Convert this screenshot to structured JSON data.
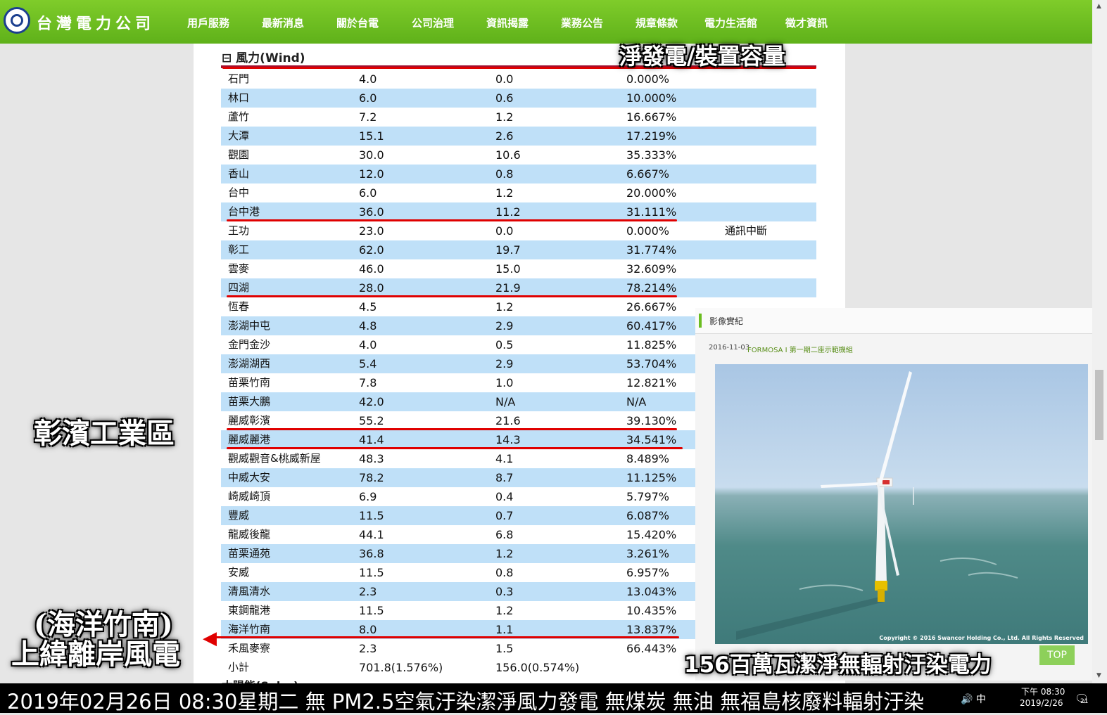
{
  "header": {
    "logo_text": "台灣電力公司",
    "nav": [
      "用戶服務",
      "最新消息",
      "關於台電",
      "公司治理",
      "資訊揭露",
      "業務公告",
      "規章條款",
      "電力生活館",
      "徵才資訊"
    ]
  },
  "section": {
    "title": "風力(Wind)",
    "toggle": "⊟",
    "next_title": "太陽能(Solar)"
  },
  "table": {
    "rows": [
      {
        "name": "石門",
        "capacity": "4.0",
        "net": "0.0",
        "ratio": "0.000%",
        "note": ""
      },
      {
        "name": "林口",
        "capacity": "6.0",
        "net": "0.6",
        "ratio": "10.000%",
        "note": ""
      },
      {
        "name": "蘆竹",
        "capacity": "7.2",
        "net": "1.2",
        "ratio": "16.667%",
        "note": ""
      },
      {
        "name": "大潭",
        "capacity": "15.1",
        "net": "2.6",
        "ratio": "17.219%",
        "note": ""
      },
      {
        "name": "觀園",
        "capacity": "30.0",
        "net": "10.6",
        "ratio": "35.333%",
        "note": ""
      },
      {
        "name": "香山",
        "capacity": "12.0",
        "net": "0.8",
        "ratio": "6.667%",
        "note": ""
      },
      {
        "name": "台中",
        "capacity": "6.0",
        "net": "1.2",
        "ratio": "20.000%",
        "note": ""
      },
      {
        "name": "台中港",
        "capacity": "36.0",
        "net": "11.2",
        "ratio": "31.111%",
        "note": ""
      },
      {
        "name": "王功",
        "capacity": "23.0",
        "net": "0.0",
        "ratio": "0.000%",
        "note": "通訊中斷"
      },
      {
        "name": "彰工",
        "capacity": "62.0",
        "net": "19.7",
        "ratio": "31.774%",
        "note": ""
      },
      {
        "name": "雲麥",
        "capacity": "46.0",
        "net": "15.0",
        "ratio": "32.609%",
        "note": ""
      },
      {
        "name": "四湖",
        "capacity": "28.0",
        "net": "21.9",
        "ratio": "78.214%",
        "note": ""
      },
      {
        "name": "恆春",
        "capacity": "4.5",
        "net": "1.2",
        "ratio": "26.667%",
        "note": ""
      },
      {
        "name": "澎湖中屯",
        "capacity": "4.8",
        "net": "2.9",
        "ratio": "60.417%",
        "note": ""
      },
      {
        "name": "金門金沙",
        "capacity": "4.0",
        "net": "0.5",
        "ratio": "11.825%",
        "note": ""
      },
      {
        "name": "澎湖湖西",
        "capacity": "5.4",
        "net": "2.9",
        "ratio": "53.704%",
        "note": ""
      },
      {
        "name": "苗栗竹南",
        "capacity": "7.8",
        "net": "1.0",
        "ratio": "12.821%",
        "note": ""
      },
      {
        "name": "苗栗大鵬",
        "capacity": "42.0",
        "net": "N/A",
        "ratio": "N/A",
        "note": ""
      },
      {
        "name": "麗威彰濱",
        "capacity": "55.2",
        "net": "21.6",
        "ratio": "39.130%",
        "note": ""
      },
      {
        "name": "麗威麗港",
        "capacity": "41.4",
        "net": "14.3",
        "ratio": "34.541%",
        "note": ""
      },
      {
        "name": "觀威觀音&桃威新屋",
        "capacity": "48.3",
        "net": "4.1",
        "ratio": "8.489%",
        "note": ""
      },
      {
        "name": "中威大安",
        "capacity": "78.2",
        "net": "8.7",
        "ratio": "11.125%",
        "note": ""
      },
      {
        "name": "崎威崎頂",
        "capacity": "6.9",
        "net": "0.4",
        "ratio": "5.797%",
        "note": ""
      },
      {
        "name": "豐威",
        "capacity": "11.5",
        "net": "0.7",
        "ratio": "6.087%",
        "note": ""
      },
      {
        "name": "龍威後龍",
        "capacity": "44.1",
        "net": "6.8",
        "ratio": "15.420%",
        "note": ""
      },
      {
        "name": "苗栗通苑",
        "capacity": "36.8",
        "net": "1.2",
        "ratio": "3.261%",
        "note": ""
      },
      {
        "name": "安威",
        "capacity": "11.5",
        "net": "0.8",
        "ratio": "6.957%",
        "note": ""
      },
      {
        "name": "清風清水",
        "capacity": "2.3",
        "net": "0.3",
        "ratio": "13.043%",
        "note": ""
      },
      {
        "name": "東鋼龍港",
        "capacity": "11.5",
        "net": "1.2",
        "ratio": "10.435%",
        "note": ""
      },
      {
        "name": "海洋竹南",
        "capacity": "8.0",
        "net": "1.1",
        "ratio": "13.837%",
        "note": ""
      },
      {
        "name": "禾風麥寮",
        "capacity": "2.3",
        "net": "1.5",
        "ratio": "66.443%",
        "note": ""
      }
    ],
    "subtotal": {
      "name": "小計",
      "capacity": "701.8(1.576%)",
      "net": "156.0(0.574%)"
    }
  },
  "captions": {
    "top_right": "淨發電/裝置容量",
    "left_mid": "彰濱工業區",
    "left_bottom_1": "(海洋竹南)",
    "left_bottom_2": "上緯離岸風電",
    "bottom_right": "156百萬瓦潔淨無輻射汙染電力",
    "arrow": "◀"
  },
  "photo_panel": {
    "heading": "影像實紀",
    "date": "2016-11-03",
    "caption": "FORMOSA I 第一期二座示範機組",
    "copyright": "Copyright © 2016 Swancor Holding Co., Ltd. All Rights Reserved"
  },
  "top_button": "TOP",
  "taskbar": {
    "banner": "2019年02月26日 08:30星期二  無 PM2.5空氣汙染潔淨風力發電 無煤炭 無油 無福島核廢料輻射汙染",
    "tray": "🔊 中",
    "time": "下午 08:30",
    "date": "2019/2/26",
    "notification_count": "21"
  },
  "colors": {
    "nav_green": "#6bbd20",
    "row_alt": "#bfe0f8",
    "section_line": "#a01030",
    "underline": "#e00000"
  }
}
